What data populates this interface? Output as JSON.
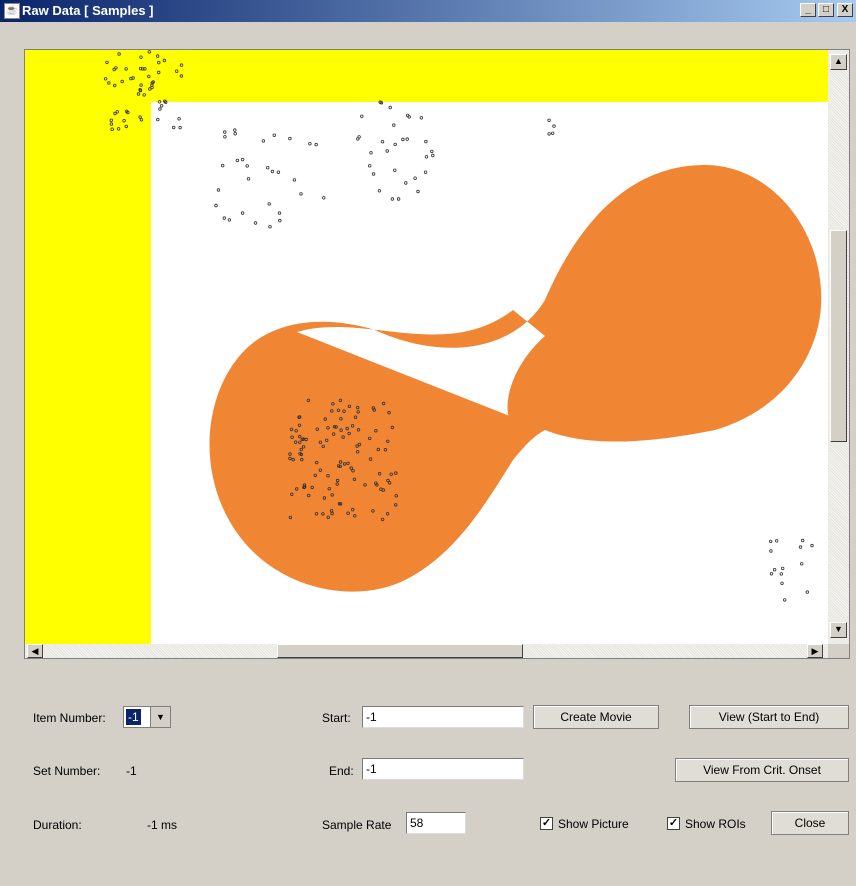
{
  "window": {
    "title": "Raw Data [ Samples ]",
    "min_glyph": "_",
    "max_glyph": "□",
    "close_glyph": "X",
    "icon": "java-cup-icon"
  },
  "scroll": {
    "up": "▲",
    "down": "▼",
    "left": "◀",
    "right": "▶"
  },
  "colors": {
    "yellow": "#ffff00",
    "roi": "#f08533",
    "sample_point": "#333333"
  },
  "controls": {
    "item_number_label": "Item Number:",
    "item_number_value": "-1",
    "set_number_label": "Set Number:",
    "set_number_value": "-1",
    "duration_label": "Duration:",
    "duration_value": "-1 ms",
    "start_label": "Start:",
    "start_value": "-1",
    "end_label": "End:",
    "end_value": "-1",
    "sample_rate_label": "Sample Rate",
    "sample_rate_value": "58",
    "create_movie": "Create Movie",
    "view_start_end": "View (Start to End)",
    "view_crit_onset": "View From Crit. Onset",
    "show_picture": "Show Picture",
    "show_rois": "Show ROIs",
    "close": "Close",
    "checkmark": "✓"
  }
}
